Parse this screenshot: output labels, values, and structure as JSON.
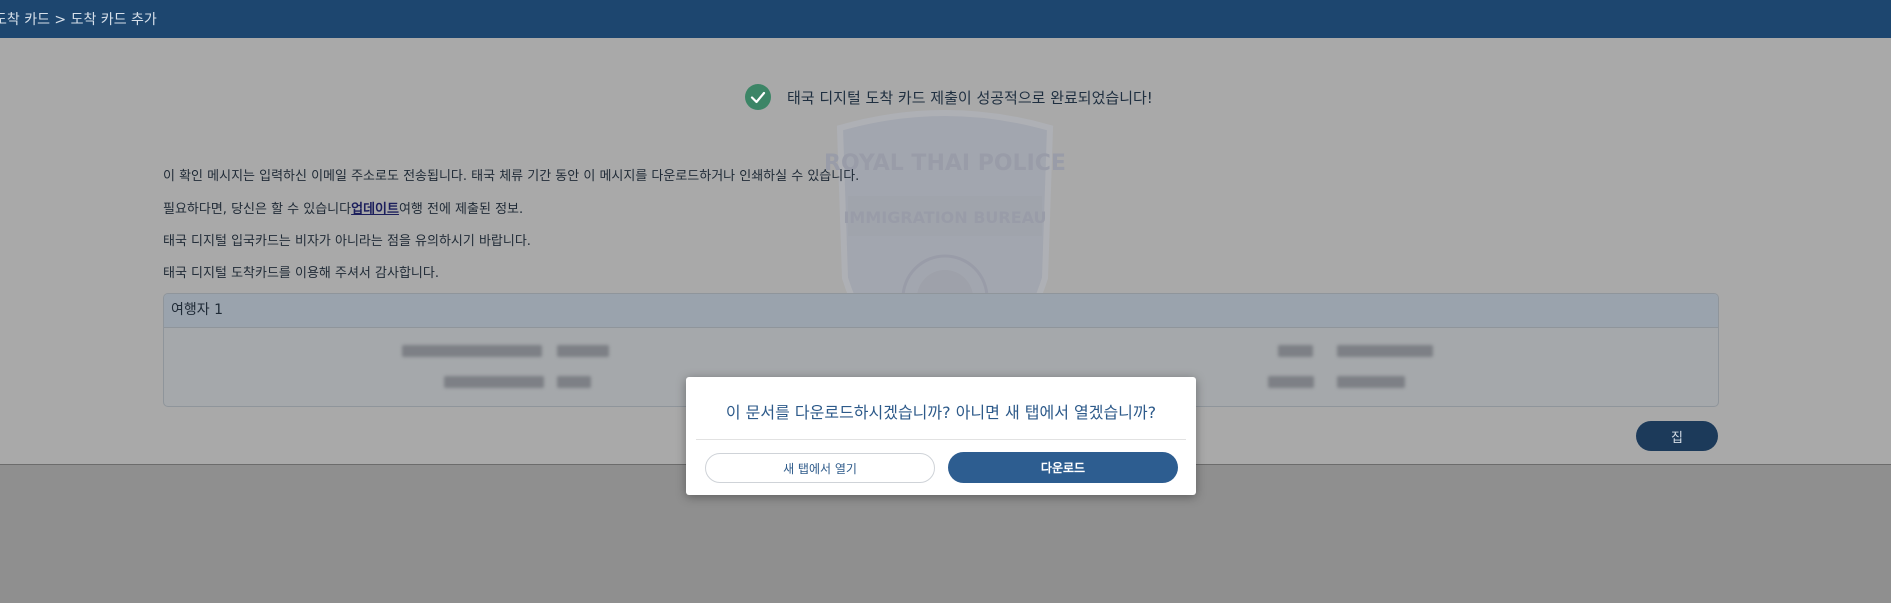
{
  "header": {
    "breadcrumb": "도착 카드 > 도착 카드 추가"
  },
  "success": {
    "message": "태국 디지털 도착 카드 제출이 성공적으로 완료되었습니다!",
    "icon": "check-circle-icon",
    "icon_color": "#3c8566"
  },
  "watermark": {
    "top_text": "ROYAL THAI POLICE",
    "band_text": "IMMIGRATION BUREAU"
  },
  "messages": {
    "line1": "이 확인 메시지는 입력하신 이메일 주소로도 전송됩니다. 태국 체류 기간 동안 이 메시지를 다운로드하거나 인쇄하실 수 있습니다.",
    "line2_before": "필요하다면, 당신은 할 수 있습니다",
    "line2_link": "업데이트",
    "line2_after": "여행 전에 제출된 정보.",
    "line3": "태국 디지털 입국카드는 비자가 아니라는 점을 유의하시기 바랍니다.",
    "line4": "태국 디지털 도착카드를 이용해 주셔서 감사합니다."
  },
  "traveler": {
    "title": "여행자 1"
  },
  "home_button": "집",
  "modal": {
    "title": "이 문서를 다운로드하시겠습니까? 아니면 새 탭에서 열겠습니까?",
    "open_label": "새 탭에서 열기",
    "download_label": "다운로드"
  },
  "colors": {
    "header_bg": "#1d466f",
    "primary": "#2d5d90",
    "link": "#1c1f5c"
  }
}
